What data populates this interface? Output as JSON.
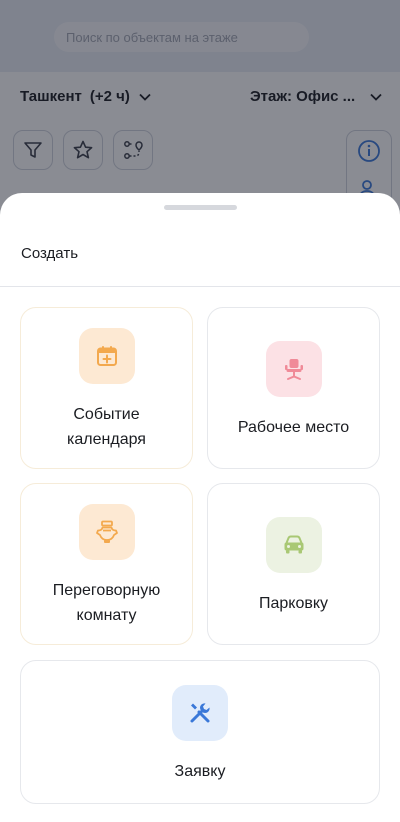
{
  "app": {
    "search_placeholder": "Поиск по объектам на этаже",
    "city": "Ташкент",
    "timezone": "(+2 ч)",
    "floor": "Этаж: Офис ...",
    "overlay_color": "#161a28"
  },
  "sheet": {
    "title": "Создать",
    "cards": [
      {
        "label": "Событие календаря",
        "icon": "calendar-add-icon",
        "icon_bg": "#fde9d3",
        "icon_color": "#f3a94e"
      },
      {
        "label": "Рабочее место",
        "icon": "office-chair-icon",
        "icon_bg": "#fce1e5",
        "icon_color": "#f08a98"
      },
      {
        "label": "Переговорную комнату",
        "icon": "meeting-room-icon",
        "icon_bg": "#fde9d3",
        "icon_color": "#f3a94e"
      },
      {
        "label": "Парковку",
        "icon": "car-icon",
        "icon_bg": "#ecf2e2",
        "icon_color": "#a9c874"
      },
      {
        "label": "Заявку",
        "icon": "tools-icon",
        "icon_bg": "#e1ecfb",
        "icon_color": "#3a78d8"
      }
    ]
  }
}
